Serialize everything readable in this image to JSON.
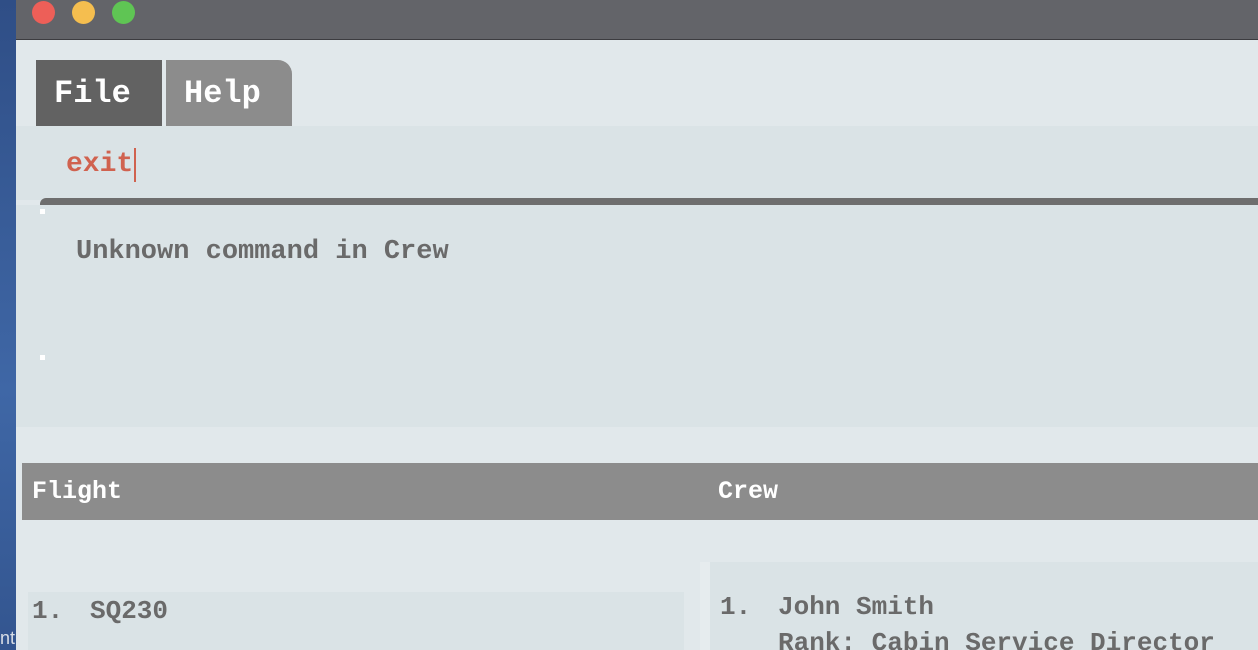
{
  "window": {
    "controls": [
      "close",
      "minimize",
      "zoom"
    ]
  },
  "desktop": {
    "edge_text": "nt"
  },
  "menu": {
    "items": [
      {
        "label": "File"
      },
      {
        "label": "Help"
      }
    ]
  },
  "command": {
    "value": "exit"
  },
  "result": {
    "message": "Unknown command in Crew"
  },
  "lists": {
    "flight_header": "Flight",
    "crew_header": "Crew",
    "flights": [
      {
        "index": "1.",
        "code": "SQ230"
      }
    ],
    "crew": [
      {
        "index": "1.",
        "name": "John Smith",
        "rank": "Rank: Cabin Service Director"
      }
    ]
  },
  "colors": {
    "command_text": "#d0624f",
    "header_bg": "#8c8c8c",
    "panel_bg": "#dae3e6"
  }
}
